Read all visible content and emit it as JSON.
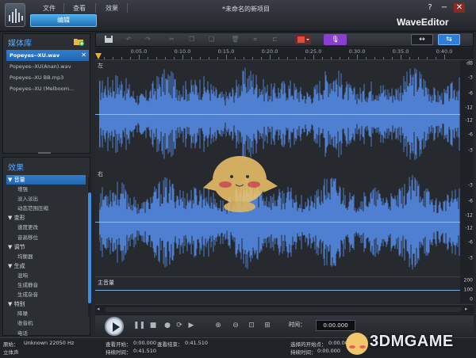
{
  "app": {
    "title": "*未命名的新项目",
    "brand": "WaveEditor",
    "edit_tab": "编辑"
  },
  "menu": {
    "file": "文件",
    "view": "查看",
    "effects": "效果"
  },
  "window_controls": {
    "help": "?",
    "minimize": "−",
    "close": "✕"
  },
  "media_library": {
    "title": "媒体库",
    "items": [
      {
        "label": "Popeyes--XU.wav",
        "selected": true
      },
      {
        "label": "Popeyes--XU(Anan).wav",
        "selected": false
      },
      {
        "label": "Popeyes--XU BB.mp3",
        "selected": false
      },
      {
        "label": "Popeyes--XU (Melboom...",
        "selected": false
      }
    ],
    "remove_icon": "✕"
  },
  "effects": {
    "title": "效果",
    "tree": [
      {
        "type": "cat",
        "label": "▼ 音量",
        "selected": true
      },
      {
        "type": "item",
        "label": "增强"
      },
      {
        "type": "item",
        "label": "淡入淡出"
      },
      {
        "type": "item",
        "label": "动态范围压缩"
      },
      {
        "type": "cat",
        "label": "▼ 变形"
      },
      {
        "type": "item",
        "label": "速度更改"
      },
      {
        "type": "item",
        "label": "音高移位"
      },
      {
        "type": "cat",
        "label": "▼ 调节"
      },
      {
        "type": "item",
        "label": "均衡器"
      },
      {
        "type": "cat",
        "label": "▼ 生成"
      },
      {
        "type": "item",
        "label": "混响"
      },
      {
        "type": "item",
        "label": "生成静音"
      },
      {
        "type": "item",
        "label": "生成杂音"
      },
      {
        "type": "cat",
        "label": "▼ 特别"
      },
      {
        "type": "item",
        "label": "降噪"
      },
      {
        "type": "item",
        "label": "收音机"
      },
      {
        "type": "item",
        "label": "电话"
      }
    ]
  },
  "toolbar": {
    "icons": [
      "save-icon",
      "undo-icon",
      "redo-icon",
      "cut-icon",
      "copy-icon",
      "paste-icon",
      "delete-icon",
      "crop-icon",
      "record-icon",
      "microphone-icon",
      "fit-icon",
      "zoom-fit-icon"
    ],
    "mic_glyph": "🎙",
    "fit_glyph": "↔",
    "zoomfit_glyph": "⇆"
  },
  "timeline": {
    "ticks": [
      "0:05.0",
      "0:10.0",
      "0:15.0",
      "0:20.0",
      "0:25.0",
      "0:30.0",
      "0:35.0",
      "0:40.0"
    ]
  },
  "channels": {
    "left_label": "左",
    "right_label": "右",
    "master_label": "主音量",
    "db_unit": "dB"
  },
  "db_scale": [
    "-3",
    "-6",
    "-12",
    "-12",
    "-6",
    "-3"
  ],
  "vol_scale": [
    "200",
    "100",
    "0"
  ],
  "transport": {
    "time_label": "时间：",
    "time_value": "0:00.000"
  },
  "status": {
    "format_label": "原始：",
    "format_value": "Unknown  22050 Hz",
    "channel_mode": "立体声",
    "view_start_label": "查看开始：",
    "view_start": "0:00.000",
    "view_end_label": "查看结束：",
    "view_end": "0:41.510",
    "duration_label": "持续时间：",
    "duration": "0:41.510",
    "sel_start_label": "选择的开始点：",
    "sel_start": "0:00.000",
    "sel_duration_label": "持续时间：",
    "sel_duration": "0:00.000"
  },
  "watermark": "3DMGAME",
  "colors": {
    "accent": "#2f7dd0",
    "waveform": "#4f7fd0",
    "mic": "#8a3fd0",
    "background": "#24272b"
  }
}
